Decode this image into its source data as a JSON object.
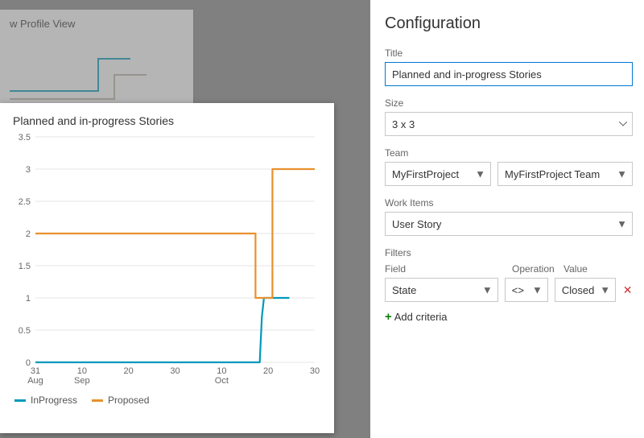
{
  "background": {
    "card_title": "w Profile View"
  },
  "preview": {
    "title": "Planned and in-progress Stories"
  },
  "chart_data": {
    "type": "line",
    "title": "Planned and in-progress Stories",
    "xlabel": "",
    "ylabel": "",
    "ylim": [
      0,
      3.5
    ],
    "y_ticks": [
      0,
      0.5,
      1,
      1.5,
      2,
      2.5,
      3,
      3.5
    ],
    "x_ticks": [
      "31 Aug",
      "10 Sep",
      "20",
      "30",
      "10 Oct",
      "20",
      "30"
    ],
    "series": [
      {
        "name": "InProgress",
        "color": "#0099bc",
        "points": [
          {
            "x": 0,
            "y": 0
          },
          {
            "x": 53,
            "y": 0
          },
          {
            "x": 53.5,
            "y": 0.7
          },
          {
            "x": 54,
            "y": 1
          },
          {
            "x": 60,
            "y": 1
          }
        ]
      },
      {
        "name": "Proposed",
        "color": "#e8912d",
        "points": [
          {
            "x": 0,
            "y": 2
          },
          {
            "x": 52,
            "y": 2
          },
          {
            "x": 52,
            "y": 1
          },
          {
            "x": 56,
            "y": 1
          },
          {
            "x": 56,
            "y": 3
          },
          {
            "x": 66,
            "y": 3
          }
        ]
      }
    ],
    "x_domain_fraction": 66
  },
  "config": {
    "panel_title": "Configuration",
    "title_label": "Title",
    "title_value": "Planned and in-progress Stories",
    "size_label": "Size",
    "size_value": "3 x 3",
    "team_label": "Team",
    "team_project": "MyFirstProject",
    "team_team": "MyFirstProject Team",
    "workitems_label": "Work Items",
    "workitems_value": "User Story",
    "filters_label": "Filters",
    "filters_columns": {
      "field": "Field",
      "operation": "Operation",
      "value": "Value"
    },
    "filter_rows": [
      {
        "field": "State",
        "op": "<>",
        "value": "Closed"
      }
    ],
    "add_criteria_label": "Add criteria"
  }
}
